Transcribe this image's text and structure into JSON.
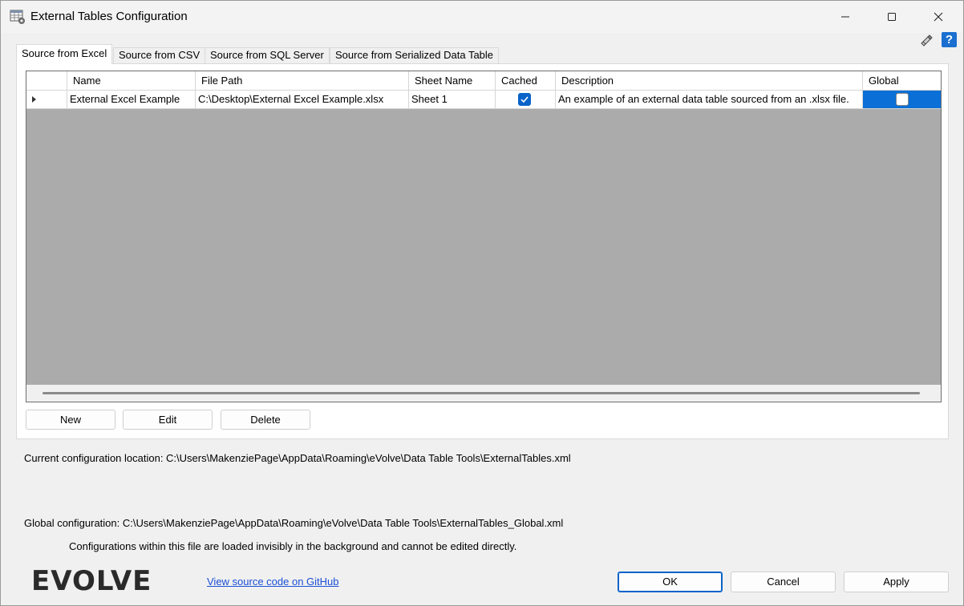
{
  "window": {
    "title": "External Tables Configuration",
    "minimize_glyph": "—",
    "maximize_glyph": "☐",
    "close_glyph": "✕"
  },
  "help_glyph": "?",
  "tabs": [
    {
      "label": "Source from Excel",
      "active": true
    },
    {
      "label": "Source from CSV",
      "active": false
    },
    {
      "label": "Source from SQL Server",
      "active": false
    },
    {
      "label": "Source from Serialized Data Table",
      "active": false
    }
  ],
  "grid": {
    "columns": [
      "Name",
      "File Path",
      "Sheet Name",
      "Cached",
      "Description",
      "Global"
    ],
    "rows": [
      {
        "name": "External Excel Example",
        "file_path": "C:\\Desktop\\External Excel Example.xlsx",
        "sheet_name": "Sheet 1",
        "cached": true,
        "description": "An example of an external data table sourced from an .xlsx file.",
        "global": false
      }
    ]
  },
  "buttons": {
    "new": "New",
    "edit": "Edit",
    "delete": "Delete",
    "ok": "OK",
    "cancel": "Cancel",
    "apply": "Apply"
  },
  "info": {
    "current_config": "Current configuration location:  C:\\Users\\MakenziePage\\AppData\\Roaming\\eVolve\\Data Table Tools\\ExternalTables.xml",
    "global_config": "Global configuration:  C:\\Users\\MakenziePage\\AppData\\Roaming\\eVolve\\Data Table Tools\\ExternalTables_Global.xml",
    "global_note": "Configurations within this file are loaded invisibly in the background and cannot be edited directly."
  },
  "footer": {
    "logo_text": "EVOLVE",
    "github_link": "View source code on GitHub"
  },
  "colors": {
    "selection": "#0a6fd6",
    "accent": "#0a63c9",
    "grid_background": "#ababab",
    "link": "#1a4fd6"
  }
}
